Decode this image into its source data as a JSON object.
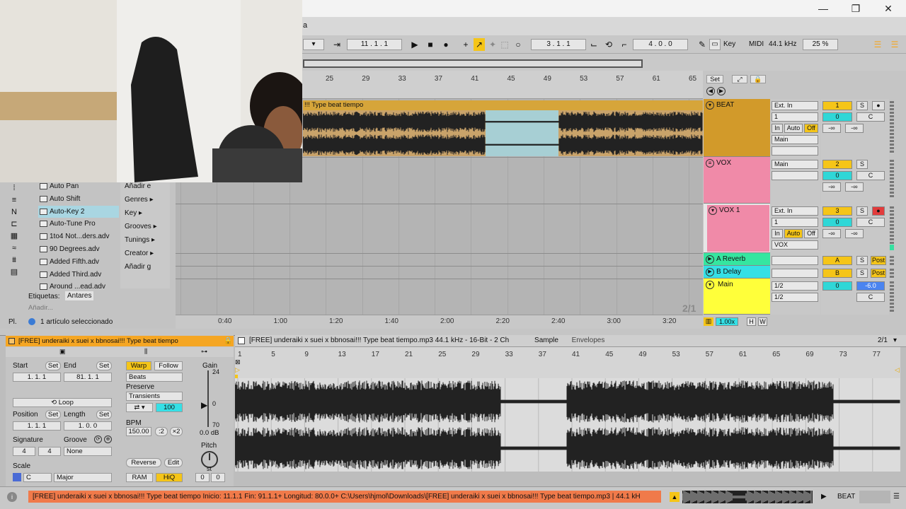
{
  "window": {
    "minimize": "—",
    "maximize": "❐",
    "close": "✕",
    "title_fragment": "a"
  },
  "transport": {
    "position": "11 .  1 .  1",
    "loop_start": "3 .  1 .  1",
    "loop_length": "4 .  0 .  0",
    "key_label": "Key",
    "midi_label": "MIDI",
    "sample_rate": "44.1 kHz",
    "cpu": "25 %"
  },
  "arrangement": {
    "ruler_bars": [
      "25",
      "29",
      "33",
      "37",
      "41",
      "45",
      "49",
      "53",
      "57",
      "61",
      "65"
    ],
    "set_label": "Set",
    "time_labels": [
      "0:40",
      "1:00",
      "1:20",
      "1:40",
      "2:00",
      "2:20",
      "2:40",
      "3:00",
      "3:20"
    ],
    "grid_label": "2/1",
    "clip_title": "!!! Type beat tiempo",
    "zoom": "1.00x",
    "h_label": "H",
    "w_label": "W"
  },
  "tracks": [
    {
      "name": "BEAT",
      "color": "#d29a2a",
      "input": "Ext. In",
      "channel": "1",
      "monitor": [
        "In",
        "Auto",
        "Off"
      ],
      "output": "Main",
      "number": "1",
      "vol": "0",
      "pan": "C",
      "sends": [
        "-∞",
        "-∞"
      ]
    },
    {
      "name": "VOX",
      "color": "#f08aa8",
      "input": "Main",
      "number": "2",
      "vol": "0",
      "pan": "C",
      "sends": [
        "-∞",
        "-∞"
      ]
    },
    {
      "name": "VOX 1",
      "color": "#f08aa8",
      "input": "Ext. In",
      "channel": "1",
      "monitor": [
        "In",
        "Auto",
        "Off"
      ],
      "output": "VOX",
      "number": "3",
      "vol": "0",
      "pan": "C",
      "sends": [
        "-∞",
        "-∞"
      ]
    },
    {
      "name": "A Reverb",
      "color": "#35e6a0",
      "number": "A",
      "post": "Post"
    },
    {
      "name": "B Delay",
      "color": "#35e0e6",
      "number": "B",
      "post": "Post"
    },
    {
      "name": "Main",
      "color": "#ffff3a",
      "routing1": "1/2",
      "routing2": "1/2",
      "vol": "0",
      "db": "-6.0",
      "pan": "C"
    }
  ],
  "browser": {
    "items": [
      "Auto Pan",
      "Auto Shift",
      "Auto-Key 2",
      "Auto-Tune Pro",
      "1to4 Not...ders.adv",
      "90 Degrees.adv",
      "Added Fifth.adv",
      "Added Third.adv",
      "Around ...ead.adv"
    ],
    "categories": [
      "Añadir e",
      "Genres ▸",
      "Key ▸",
      "Grooves ▸",
      "Tunings ▸",
      "Creator ▸",
      "Añadir g"
    ],
    "tags_label": "Etiquetas:",
    "tag": "Antares",
    "add_placeholder": "Añadir...",
    "selection_status": "1 artículo seleccionado",
    "pl_label": "Pl."
  },
  "clip": {
    "title": "[FREE] underaiki  x suei x bbnosai!!! Type beat tiempo",
    "start_label": "Start",
    "end_label": "End",
    "set_label": "Set",
    "start": "1.   1.   1",
    "end": "81.   1.   1",
    "loop": "Loop",
    "position_label": "Position",
    "length_label": "Length",
    "position": "1.   1.   1",
    "length": "1.   0.   0",
    "signature_label": "Signature",
    "groove_label": "Groove",
    "sig_num": "4",
    "sig_den": "4",
    "groove": "None",
    "scale_label": "Scale",
    "scale_root": "C",
    "scale_mode": "Major",
    "warp": "Warp",
    "follow": "Follow",
    "warp_mode": "Beats",
    "preserve_label": "Preserve",
    "preserve": "Transients",
    "transient_value": "100",
    "bpm_label": "BPM",
    "bpm": "150.00",
    "half": ":2",
    "double": "×2",
    "reverse": "Reverse",
    "edit": "Edit",
    "ram": "RAM",
    "hiq": "HiQ",
    "gain_label": "Gain",
    "gain_top": "24",
    "gain_zero": "0",
    "gain_bottom": "70",
    "gain_db": "0.0 dB",
    "pitch_label": "Pitch",
    "pitch_unit": "st",
    "pitch_st": "0",
    "pitch_ct": "0"
  },
  "sample": {
    "info": "[FREE] underaiki  x suei x bbnosai!!! Type beat tiempo.mp3  44.1 kHz - 16-Bit - 2 Ch",
    "tab_sample": "Sample",
    "tab_envelopes": "Envelopes",
    "grid": "2/1",
    "ruler": [
      "1",
      "5",
      "9",
      "13",
      "17",
      "21",
      "25",
      "29",
      "33",
      "37",
      "41",
      "45",
      "49",
      "53",
      "57",
      "61",
      "65",
      "69",
      "73",
      "77"
    ]
  },
  "status": {
    "message": "[FREE] underaiki  x suei x bbnosai!!! Type beat tiempo  Inicio: 11.1.1  Fin: 91.1.1+  Longitud: 80.0.0+  C:\\Users\\hjmol\\Downloads\\[FREE] underaiki  x suei x bbnosai!!! Type beat tiempo.mp3 | 44.1 kH",
    "track_label": "BEAT"
  }
}
